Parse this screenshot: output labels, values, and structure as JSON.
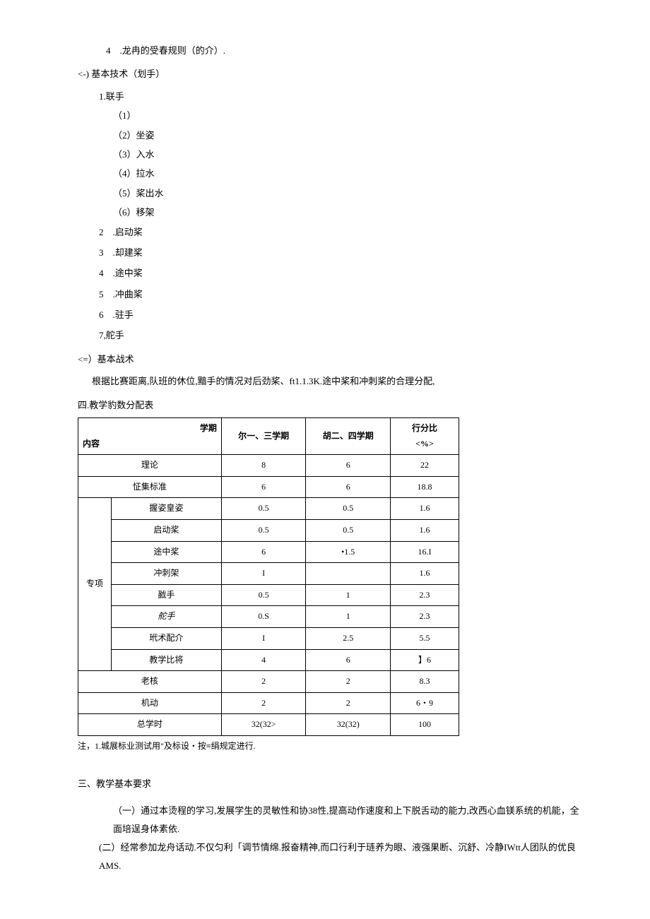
{
  "intro_item4": "4　.龙冉的受春规则（的介）.",
  "sec_b_header": "<-)  基本技术（划手）",
  "list1_title": "1.联手",
  "sub1": "（1）",
  "sub2": "（2）坐姿",
  "sub3": "（3）入水",
  "sub4": "（4）拉水",
  "sub5": "（5）桨出水",
  "sub6": "（6）移架",
  "num2": "2　.启动桨",
  "num3": "3　.却建桨",
  "num4": "4　.途中桨",
  "num5": "5　.冲曲桨",
  "num6": "6　.驻手",
  "num7": "7,舵手",
  "sec_c_header": "<=）基本战术",
  "tactic_desc": "根据比赛距离,队班的休位,黯手的情况对后劲桨、ft1.1.3K.途中桨和冲刺桨的合理分配,",
  "table_title": "四.教学豹数分配表",
  "th_diag_top": "学期",
  "th_diag_bottom": "内容",
  "th_col1": "尔一、三学期",
  "th_col2": "胡二、四学期",
  "th_col3_a": "行分比",
  "th_col3_b": "<%>",
  "row_theory": "理论",
  "row_theory_v1": "8",
  "row_theory_v2": "6",
  "row_theory_v3": "22",
  "row_std": "怔集标准",
  "row_std_v1": "6",
  "row_std_v2": "6",
  "row_std_v3": "18.8",
  "group_label": "专项",
  "r_grip": "握姿皇姿",
  "r_grip_v1": "0.5",
  "r_grip_v2": "0.5",
  "r_grip_v3": "1.6",
  "r_start": "启动桨",
  "r_start_v1": "0.5",
  "r_start_v2": "0.5",
  "r_start_v3": "1.6",
  "r_mid": "途中桨",
  "r_mid_v1": "6",
  "r_mid_v2": "•1.5",
  "r_mid_v3": "16.I",
  "r_sprint": "冲刺架",
  "r_sprint_v1": "I",
  "r_sprint_v2": "",
  "r_sprint_v3": "1.6",
  "r_drum": "戤手",
  "r_drum_v1": "0.5",
  "r_drum_v2": "1",
  "r_drum_v3": "2.3",
  "r_helm": "舵手",
  "r_helm_v1": "0.S",
  "r_helm_v2": "1",
  "r_helm_v3": "2.3",
  "r_tac": "玳术配介",
  "r_tac_v1": "I",
  "r_tac_v2": "2.5",
  "r_tac_v3": "5.5",
  "r_teach": "教学比将",
  "r_teach_v1": "4",
  "r_teach_v2": "6",
  "r_teach_v3": "】6",
  "r_exam": "老核",
  "r_exam_v1": "2",
  "r_exam_v2": "2",
  "r_exam_v3": "8.3",
  "r_flex": "机动",
  "r_flex_v1": "2",
  "r_flex_v2": "2",
  "r_flex_v3": "6・9",
  "r_total": "总学时",
  "r_total_v1": "32(32>",
  "r_total_v2": "32(32)",
  "r_total_v3": "100",
  "table_note": "注，1.城展标业测试用\"及标设・按≡绢规定进行.",
  "sec3_title": "三、教学基本要求",
  "para1": "（一）通过本烫程的学习,发展学生的灵敏性和协38性,提高动作速度和上下脱舌动的能力,改西心血镁系统的机能，全面培逞身体素依.",
  "para2": "(二）经常参加龙舟话动.不仅匀利「调节情绵.报奋精神,而口行利于琏养为眼、液强果断、沉舒、冷静IWtt人团队的优良AMS."
}
